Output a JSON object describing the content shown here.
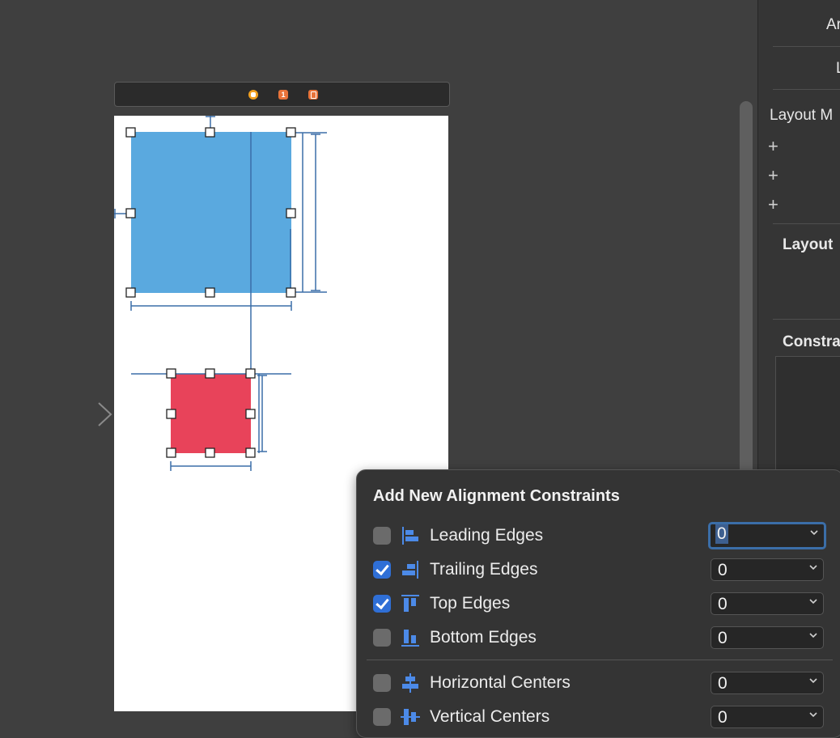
{
  "scene_dock": {
    "icons": [
      "view-controller-icon",
      "first-responder-icon",
      "exit-icon"
    ],
    "first_responder_glyph": "1"
  },
  "inspector": {
    "row1": "Ar",
    "row2": "L",
    "layout_margins_label": "Layout M",
    "layout_section": "Layout",
    "constraints_section": "Constra"
  },
  "popover": {
    "title": "Add New Alignment Constraints",
    "rows": [
      {
        "label": "Leading Edges",
        "checked": false,
        "value": "0",
        "icon": "leading-edges-icon",
        "focused": true
      },
      {
        "label": "Trailing Edges",
        "checked": true,
        "value": "0",
        "icon": "trailing-edges-icon",
        "focused": false
      },
      {
        "label": "Top Edges",
        "checked": true,
        "value": "0",
        "icon": "top-edges-icon",
        "focused": false
      },
      {
        "label": "Bottom Edges",
        "checked": false,
        "value": "0",
        "icon": "bottom-edges-icon",
        "focused": false
      },
      {
        "label": "Horizontal Centers",
        "checked": false,
        "value": "0",
        "icon": "horizontal-centers-icon",
        "focused": false
      },
      {
        "label": "Vertical Centers",
        "checked": false,
        "value": "0",
        "icon": "vertical-centers-icon",
        "focused": false
      }
    ]
  },
  "colors": {
    "blue_view": "#5aa9df",
    "red_view": "#e8435a",
    "accent": "#2f6fd6",
    "constraint_line": "#3b6ea8"
  }
}
